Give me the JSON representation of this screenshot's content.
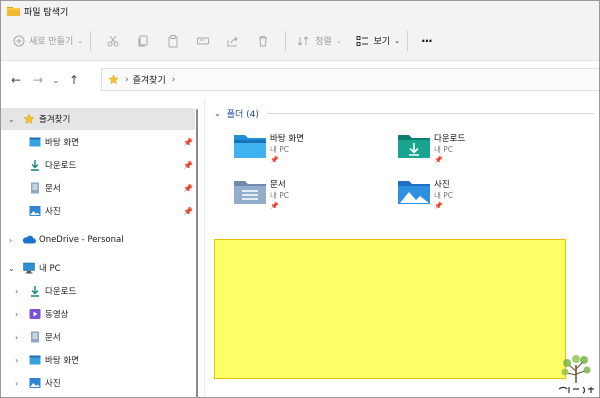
{
  "window": {
    "title": "파일 탐색기"
  },
  "toolbar": {
    "new_label": "새로 만들기",
    "sort_label": "정렬",
    "view_label": "보기",
    "more_label": "···"
  },
  "address": {
    "crumb": "즐겨찾기",
    "sep1": "›",
    "sep2": "›"
  },
  "sidebar": {
    "favorites": "즐겨찾기",
    "fav_items": [
      "바탕 화면",
      "다운로드",
      "문서",
      "사진"
    ],
    "onedrive": "OneDrive - Personal",
    "thispc": "내 PC",
    "pc_items": [
      "다운로드",
      "동영상",
      "문서",
      "바탕 화면",
      "사진"
    ]
  },
  "content": {
    "group_label": "폴더 (4)",
    "tiles": [
      {
        "name": "바탕 화면",
        "sub": "내 PC"
      },
      {
        "name": "다운로드",
        "sub": "내 PC"
      },
      {
        "name": "문서",
        "sub": "내 PC"
      },
      {
        "name": "사진",
        "sub": "내 PC"
      }
    ]
  },
  "colors": {
    "accent": "#1f4a9c",
    "highlight": "#ffff66",
    "selected": "#e5e5e5"
  }
}
